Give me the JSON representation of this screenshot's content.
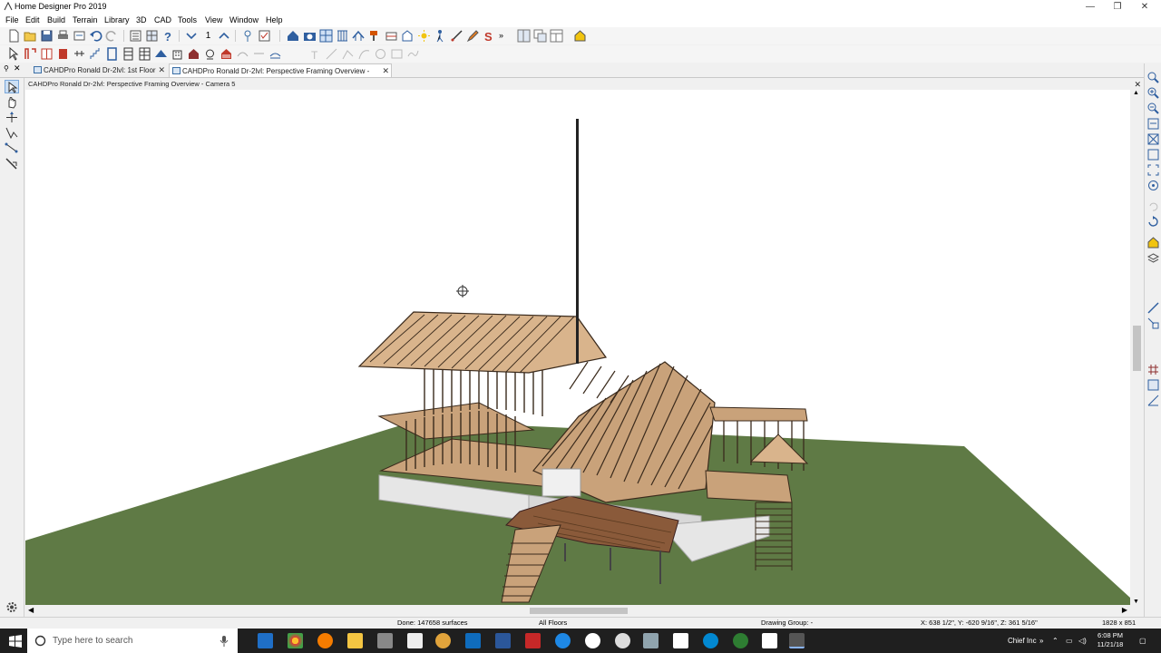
{
  "window": {
    "title": "Home Designer Pro 2019",
    "controls": {
      "minimize": "—",
      "maximize": "❐",
      "close": "✕"
    }
  },
  "menu": [
    "File",
    "Edit",
    "Build",
    "Terrain",
    "Library",
    "3D",
    "CAD",
    "Tools",
    "View",
    "Window",
    "Help"
  ],
  "toolbar": {
    "floor_number": "1"
  },
  "tabs": [
    {
      "label": "CAHDPro Ronald Dr-2lvl: 1st Floor",
      "close": "✕"
    },
    {
      "label": "CAHDPro Ronald Dr-2lvl: Perspective Framing Overview - Camera 5",
      "close": "✕"
    }
  ],
  "view": {
    "title": "CAHDPro Ronald Dr-2lvl: Perspective Framing Overview - Camera 5",
    "close": "✕"
  },
  "status": {
    "done": "Done:  147658 surfaces",
    "floors": "All Floors",
    "drawing_group": "Drawing Group: -",
    "coordinates": "X: 638 1/2\", Y: -620 9/16\", Z: 361 5/16\"",
    "dimensions": "1828 x 851"
  },
  "taskbar": {
    "search_placeholder": "Type here to search",
    "tray_label": "Chief Inc",
    "tray_chevron": "»",
    "time": "6:08 PM",
    "date": "11/21/18"
  },
  "colors": {
    "ground": "#5f7a45",
    "lumber": "#c9a27a",
    "lumber_dark": "#3a2a1c",
    "foundation": "#e6e6e6",
    "deck": "#8a5a3a"
  },
  "icons": {
    "left_tools": [
      "select-objects-icon",
      "pan-icon",
      "edit-handle-icon",
      "reshape-icon",
      "transform-icon",
      "camera-tool-icon"
    ],
    "right_tools": [
      "zoom-icon",
      "zoom-in-icon",
      "zoom-out-icon",
      "undo-zoom-icon",
      "fill-window-icon",
      "fit-view-icon",
      "expand-icon",
      "orbit-icon",
      "refresh-icon",
      "material-icon",
      "layer-icon",
      "stair-icon",
      "grid-icon",
      "snap-icon",
      "settings-icon"
    ]
  }
}
